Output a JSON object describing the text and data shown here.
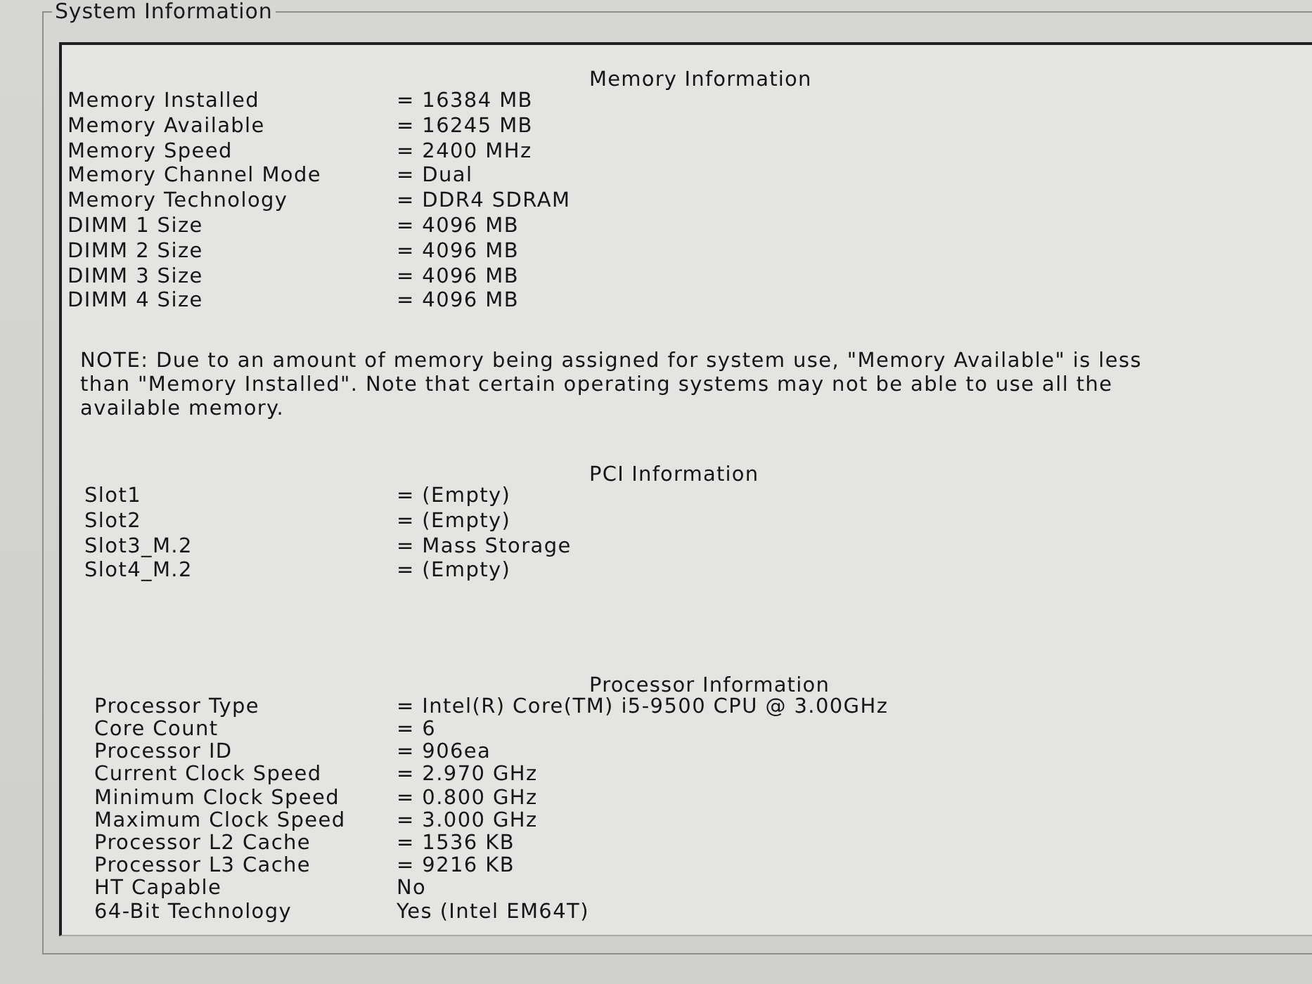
{
  "group_box": {
    "title": "System Information"
  },
  "sections": [
    {
      "heading": "Memory Information",
      "rows": [
        {
          "label": "Memory Installed",
          "value": "= 16384 MB"
        },
        {
          "label": "Memory Available",
          "value": "= 16245 MB"
        },
        {
          "label": "Memory Speed",
          "value": "= 2400 MHz"
        },
        {
          "label": "Memory Channel Mode",
          "value": "= Dual"
        },
        {
          "label": "Memory Technology",
          "value": "= DDR4 SDRAM"
        },
        {
          "label": "DIMM 1 Size",
          "value": "= 4096 MB"
        },
        {
          "label": "DIMM 2 Size",
          "value": "= 4096 MB"
        },
        {
          "label": "DIMM 3 Size",
          "value": "= 4096 MB"
        },
        {
          "label": "DIMM 4 Size",
          "value": "= 4096 MB"
        }
      ],
      "note": "NOTE: Due to an amount of memory being assigned for system use, \"Memory Available\" is less than \"Memory Installed\". Note that certain operating systems may not be able to use all the available memory."
    },
    {
      "heading": "PCI Information",
      "rows": [
        {
          "label": "Slot1",
          "value": "= (Empty)"
        },
        {
          "label": "Slot2",
          "value": "= (Empty)"
        },
        {
          "label": "Slot3_M.2",
          "value": "= Mass Storage"
        },
        {
          "label": "Slot4_M.2",
          "value": "= (Empty)"
        }
      ]
    },
    {
      "heading": "Processor Information",
      "rows": [
        {
          "label": "Processor Type",
          "value": "= Intel(R) Core(TM) i5-9500 CPU @ 3.00GHz"
        },
        {
          "label": "Core Count",
          "value": "= 6"
        },
        {
          "label": "Processor ID",
          "value": "= 906ea"
        },
        {
          "label": "Current Clock Speed",
          "value": "= 2.970 GHz"
        },
        {
          "label": "Minimum Clock Speed",
          "value": "= 0.800 GHz"
        },
        {
          "label": "Maximum Clock Speed",
          "value": "= 3.000 GHz"
        },
        {
          "label": "Processor L2 Cache",
          "value": "= 1536 KB"
        },
        {
          "label": "Processor L3 Cache",
          "value": "= 9216 KB"
        },
        {
          "label": "HT Capable",
          "value": "No"
        },
        {
          "label": "64-Bit Technology",
          "value": "Yes (Intel EM64T)"
        }
      ]
    }
  ]
}
